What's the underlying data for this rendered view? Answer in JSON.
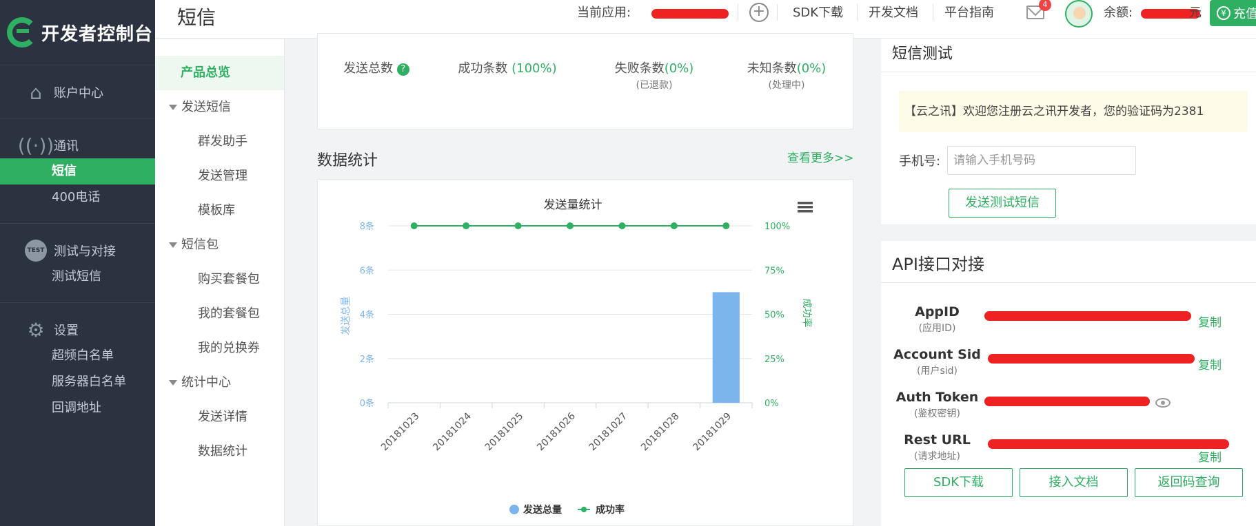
{
  "sidebar": {
    "logo_text": "开发者控制台",
    "groups": [
      {
        "label": "账户中心",
        "items": []
      },
      {
        "label": "通讯",
        "items": [
          "短信",
          "400电话"
        ]
      },
      {
        "label": "测试与对接",
        "items": [
          "测试短信"
        ]
      },
      {
        "label": "设置",
        "items": [
          "超频白名单",
          "服务器白名单",
          "回调地址"
        ]
      }
    ],
    "test_badge": "TEST",
    "active_item": "短信"
  },
  "header": {
    "page_title": "短信",
    "current_app_label": "当前应用:",
    "links": [
      "SDK下载",
      "开发文档",
      "平台指南"
    ],
    "mail_count": "4",
    "balance_label": "余额:",
    "balance_unit": "元",
    "recharge_label": "充值",
    "recharge_icon": "¥"
  },
  "submenu": {
    "overview": "产品总览",
    "groups": [
      {
        "label": "发送短信",
        "children": [
          "群发助手",
          "发送管理",
          "模板库"
        ]
      },
      {
        "label": "短信包",
        "children": [
          "购买套餐包",
          "我的套餐包",
          "我的兑换券"
        ]
      },
      {
        "label": "统计中心",
        "children": [
          "发送详情",
          "数据统计"
        ]
      }
    ]
  },
  "stats": {
    "total_label": "发送总数",
    "help_icon": "?",
    "success_label": "成功条数",
    "success_pct": "(100%)",
    "fail_label": "失败条数",
    "fail_pct": "(0%)",
    "fail_note": "(已退款)",
    "unknown_label": "未知条数",
    "unknown_pct": "(0%)",
    "unknown_note": "(处理中)"
  },
  "data_section": {
    "heading": "数据统计",
    "view_more": "查看更多>>"
  },
  "chart_data": {
    "type": "bar",
    "title": "发送量统计",
    "categories": [
      "20181023",
      "20181024",
      "20181025",
      "20181026",
      "20181027",
      "20181028",
      "20181029"
    ],
    "series": [
      {
        "name": "发送总量",
        "type": "bar",
        "axis": "left",
        "color": "#7cb5ec",
        "values": [
          0,
          0,
          0,
          0,
          0,
          0,
          5
        ]
      },
      {
        "name": "成功率",
        "type": "line",
        "axis": "right",
        "color": "#2eaf62",
        "values": [
          100,
          100,
          100,
          100,
          100,
          100,
          100
        ]
      }
    ],
    "ylabel": "发送总量",
    "y2label": "成功率",
    "ylim": [
      0,
      8
    ],
    "y2lim": [
      0,
      100
    ],
    "yticks": [
      "0条",
      "2条",
      "4条",
      "6条",
      "8条"
    ],
    "y2ticks": [
      "0%",
      "25%",
      "50%",
      "75%",
      "100%"
    ],
    "legend_position": "bottom",
    "grid": true,
    "menu_icon": "hamburger-menu-icon"
  },
  "sms_test": {
    "title": "短信测试",
    "preview": "【云之讯】欢迎您注册云之讯开发者，您的验证码为2381",
    "phone_label": "手机号:",
    "phone_placeholder": "请输入手机号码",
    "send_button": "发送测试短信"
  },
  "api": {
    "title": "API接口对接",
    "rows": [
      {
        "label": "AppID",
        "sub": "(应用ID)",
        "action": "复制"
      },
      {
        "label": "Account Sid",
        "sub": "(用户sid)",
        "action": "复制"
      },
      {
        "label": "Auth Token",
        "sub": "(鉴权密钥)",
        "action": ""
      },
      {
        "label": "Rest URL",
        "sub": "(请求地址)",
        "action": "复制"
      }
    ],
    "buttons": [
      "SDK下载",
      "接入文档",
      "返回码查询"
    ]
  },
  "colors": {
    "accent": "#2eaf62",
    "sidebar_bg": "#2b3240",
    "bar": "#7cb5ec",
    "redaction": "#ee2222"
  }
}
